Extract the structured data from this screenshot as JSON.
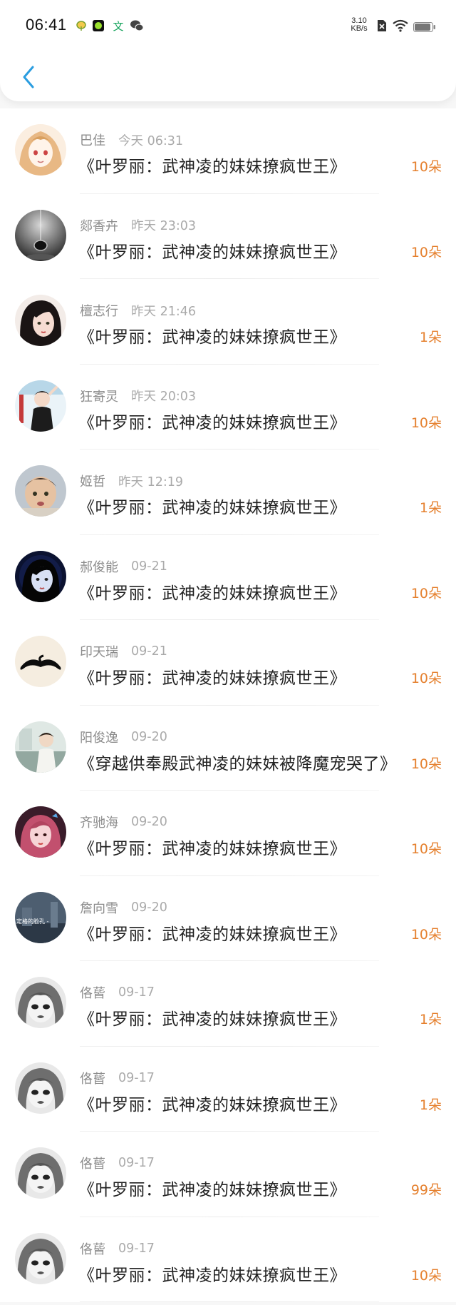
{
  "status_bar": {
    "time": "06:41",
    "net_speed_value": "3.10",
    "net_speed_unit": "KB/s",
    "icons": [
      "leaf-app-icon",
      "green-square-app-icon",
      "wen-app-icon",
      "wechat-icon",
      "sim-off-icon",
      "wifi-icon",
      "battery-icon"
    ]
  },
  "header": {
    "back_icon": "chevron-left-icon"
  },
  "colors": {
    "accent_back": "#2a9de0",
    "amount": "#e5802e",
    "name": "#8c8c8c",
    "time": "#aaaaaa"
  },
  "records": [
    {
      "name": "巴佳",
      "time": "今天 06:31",
      "title": "《叶罗丽：武神凌的妹妹撩疯世王》",
      "amount": "10朵",
      "avatar": "anime-girl"
    },
    {
      "name": "郯香卉",
      "time": "昨天 23:03",
      "title": "《叶罗丽：武神凌的妹妹撩疯世王》",
      "amount": "10朵",
      "avatar": "dark-drop"
    },
    {
      "name": "檀志行",
      "time": "昨天 21:46",
      "title": "《叶罗丽：武神凌的妹妹撩疯世王》",
      "amount": "1朵",
      "avatar": "girl-dark-hair"
    },
    {
      "name": "狂寄灵",
      "time": "昨天 20:03",
      "title": "《叶罗丽：武神凌的妹妹撩疯世王》",
      "amount": "10朵",
      "avatar": "girl-pose"
    },
    {
      "name": "姬哲",
      "time": "昨天 12:19",
      "title": "《叶罗丽：武神凌的妹妹撩疯世王》",
      "amount": "1朵",
      "avatar": "child"
    },
    {
      "name": "郝俊能",
      "time": "09-21",
      "title": "《叶罗丽：武神凌的妹妹撩疯世王》",
      "amount": "10朵",
      "avatar": "girl-blue"
    },
    {
      "name": "印天瑞",
      "time": "09-21",
      "title": "《叶罗丽：武神凌的妹妹撩疯世王》",
      "amount": "10朵",
      "avatar": "mustache"
    },
    {
      "name": "阳俊逸",
      "time": "09-20",
      "title": "《穿越供奉殿武神凌的妹妹被降魔宠哭了》",
      "amount": "10朵",
      "avatar": "boy-scene"
    },
    {
      "name": "齐驰海",
      "time": "09-20",
      "title": "《叶罗丽：武神凌的妹妹撩疯世王》",
      "amount": "10朵",
      "avatar": "girl-pink"
    },
    {
      "name": "詹向雪",
      "time": "09-20",
      "title": "《叶罗丽：武神凌的妹妹撩疯世王》",
      "amount": "10朵",
      "avatar": "city-text",
      "avatar_text": "定格的脸孔 -"
    },
    {
      "name": "佫蒈",
      "time": "09-17",
      "title": "《叶罗丽：武神凌的妹妹撩疯世王》",
      "amount": "1朵",
      "avatar": "manga-face"
    },
    {
      "name": "佫蒈",
      "time": "09-17",
      "title": "《叶罗丽：武神凌的妹妹撩疯世王》",
      "amount": "1朵",
      "avatar": "manga-face"
    },
    {
      "name": "佫蒈",
      "time": "09-17",
      "title": "《叶罗丽：武神凌的妹妹撩疯世王》",
      "amount": "99朵",
      "avatar": "manga-face"
    },
    {
      "name": "佫蒈",
      "time": "09-17",
      "title": "《叶罗丽：武神凌的妹妹撩疯世王》",
      "amount": "10朵",
      "avatar": "manga-face"
    }
  ]
}
